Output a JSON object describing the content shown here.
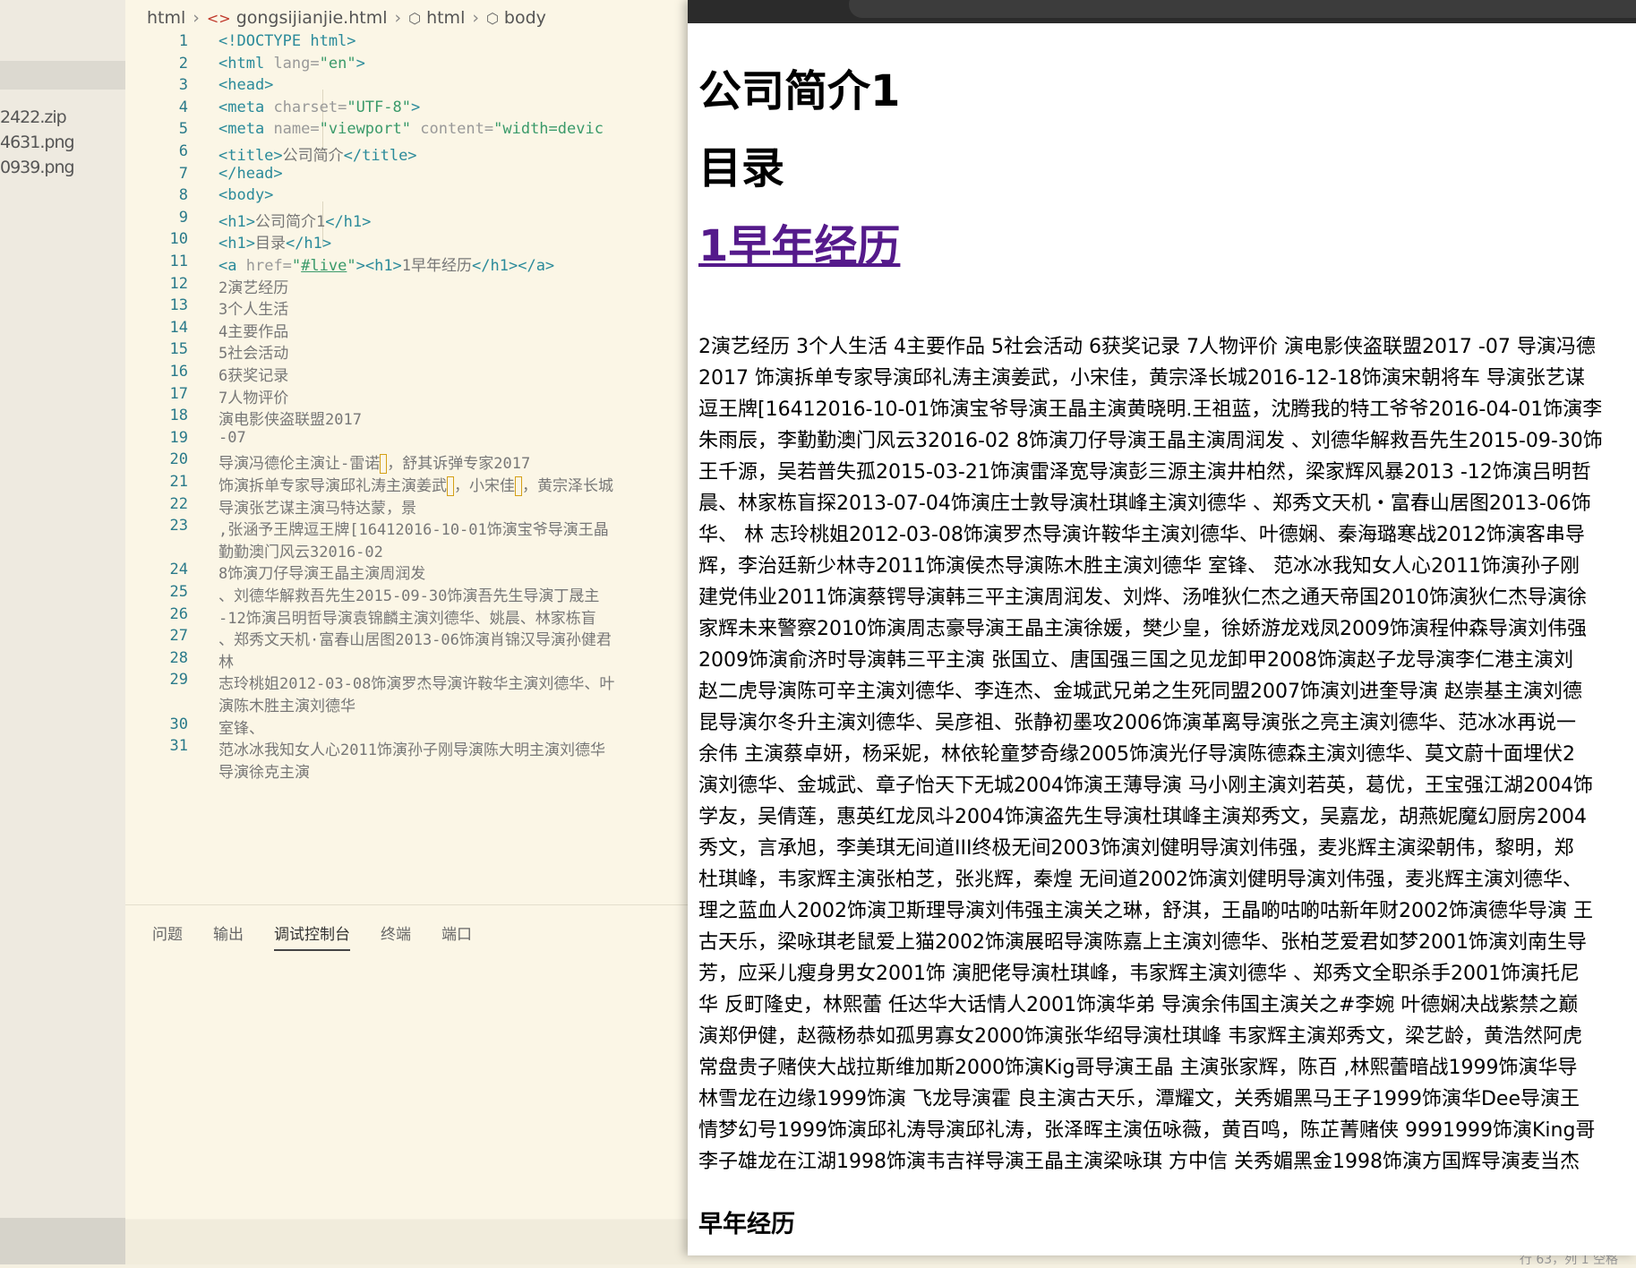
{
  "explorer": {
    "files": [
      "2422.zip",
      "4631.png",
      "0939.png"
    ]
  },
  "breadcrumb": [
    "html",
    "gongsijianjie.html",
    "html",
    "body"
  ],
  "code_lines": [
    {
      "n": "1",
      "html": "<span class='tag'>&lt;!DOCTYPE html&gt;</span>"
    },
    {
      "n": "2",
      "html": "<span class='tag'>&lt;html</span> <span class='attr'>lang=</span><span class='str'>\"en\"</span><span class='tag'>&gt;</span>"
    },
    {
      "n": "3",
      "html": "<span class='tag'>&lt;head&gt;</span>"
    },
    {
      "n": "4",
      "html": "    <span class='tag'>&lt;meta</span> <span class='attr'>charset=</span><span class='str'>\"UTF-8\"</span><span class='tag'>&gt;</span>"
    },
    {
      "n": "5",
      "html": "    <span class='tag'>&lt;meta</span> <span class='attr'>name=</span><span class='str'>\"viewport\"</span> <span class='attr'>content=</span><span class='str'>\"width=devic</span>"
    },
    {
      "n": "6",
      "html": "    <span class='tag'>&lt;title&gt;</span><span class='txt'>公司简介</span><span class='tag'>&lt;/title&gt;</span>"
    },
    {
      "n": "7",
      "html": "<span class='tag'>&lt;/head&gt;</span>"
    },
    {
      "n": "8",
      "html": "<span class='tag'>&lt;body&gt;</span>"
    },
    {
      "n": "9",
      "html": "   <span class='tag'>&lt;h1&gt;</span><span class='txt'>公司简介1</span><span class='tag'>&lt;/h1&gt;</span>"
    },
    {
      "n": "10",
      "html": "   <span class='tag'>&lt;h1&gt;</span><span class='txt'>目录</span><span class='tag'>&lt;/h1&gt;</span>"
    },
    {
      "n": "11",
      "html": "<span class='tag'>&lt;a</span> <span class='attr'>href=</span><span class='str'>\"<span class='link'>#live</span>\"</span><span class='tag'>&gt;&lt;h1&gt;</span><span class='txt'>1早年经历</span><span class='tag'>&lt;/h1&gt;&lt;/a&gt;</span>"
    },
    {
      "n": "12",
      "html": "<span class='txt'>2演艺经历</span>"
    },
    {
      "n": "13",
      "html": "<span class='txt'>3个人生活</span>"
    },
    {
      "n": "14",
      "html": "<span class='txt'>4主要作品</span>"
    },
    {
      "n": "15",
      "html": "<span class='txt'>5社会活动</span>"
    },
    {
      "n": "16",
      "html": "<span class='txt'>6获奖记录</span>"
    },
    {
      "n": "17",
      "html": "<span class='txt'>7人物评价</span>"
    },
    {
      "n": "18",
      "html": "<span class='txt'>演电影侠盗联盟2017</span>"
    },
    {
      "n": "19",
      "html": "<span class='txt'>-07</span>"
    },
    {
      "n": "20",
      "html": "<span class='txt'>导演冯德伦主演让-雷诺<span class='bx'></span>，舒其诉弹专家2017</span>"
    },
    {
      "n": "21",
      "html": "<span class='txt'>饰演拆单专家导演邱礼涛主演姜武<span class='bx'></span>，小宋佳<span class='bx'></span>，黄宗泽长城</span>"
    },
    {
      "n": "22",
      "html": "<span class='txt'>导演张艺谋主演马特达蒙，景</span>"
    },
    {
      "n": "23",
      "html": "<span class='txt'>,张涵予王牌逗王牌[16412016-10-01饰演宝爷导演王晶</span>"
    },
    {
      "n": "",
      "html": "<span class='txt'>勤勤澳门风云32016-02</span>"
    },
    {
      "n": "24",
      "html": "<span class='txt'>8饰演刀仔导演王晶主演周润发</span>"
    },
    {
      "n": "25",
      "html": "<span class='txt'>、刘德华解救吾先生2015-09-30饰演吾先生导演丁晟主</span>"
    },
    {
      "n": "26",
      "html": "<span class='txt'>-12饰演吕明哲导演袁锦麟主演刘德华、姚晨、林家栋盲</span>"
    },
    {
      "n": "27",
      "html": "<span class='txt'>、郑秀文天机·富春山居图2013-06饰演肖锦汉导演孙健君</span>"
    },
    {
      "n": "28",
      "html": "<span class='txt'>林</span>"
    },
    {
      "n": "29",
      "html": "<span class='txt'>志玲桃姐2012-03-08饰演罗杰导演许鞍华主演刘德华、叶</span>"
    },
    {
      "n": "",
      "html": "<span class='txt'>演陈木胜主演刘德华</span>"
    },
    {
      "n": "30",
      "html": "<span class='txt'>室锋、</span>"
    },
    {
      "n": "31",
      "html": "<span class='txt'>范冰冰我知女人心2011饰演孙子刚导演陈大明主演刘德华</span>"
    },
    {
      "n": "",
      "html": "<span class='txt'>导演徐克主演</span>"
    }
  ],
  "panel": {
    "tabs": [
      "问题",
      "输出",
      "调试控制台",
      "终端",
      "端口"
    ],
    "active_tab": "调试控制台",
    "prompt": ">"
  },
  "status": {
    "position": "行 63，列 1  空格"
  },
  "browser": {
    "h1_title": "公司简介1",
    "h1_toc": "目录",
    "h1_link": "1早年经历",
    "paragraph_lines": [
      "2演艺经历 3个人生活 4主要作品 5社会活动 6获奖记录 7人物评价 演电影侠盗联盟2017 -07 导演冯德",
      "2017 饰演拆单专家导演邱礼涛主演姜武，小宋佳，黄宗泽长城2016-12-18饰演宋朝将车 导演张艺谋",
      "逗王牌[16412016-10-01饰演宝爷导演王晶主演黄晓明.王祖蓝，沈腾我的特工爷爷2016-04-01饰演李",
      "朱雨辰，李勤勤澳门风云32016-02 8饰演刀仔导演王晶主演周润发 、刘德华解救吾先生2015-09-30饰",
      "王千源，吴若普失孤2015-03-21饰演雷泽宽导演彭三源主演井柏然，梁家辉风暴2013 -12饰演吕明哲",
      "晨、林家栋盲探2013-07-04饰演庄士敦导演杜琪峰主演刘德华 、郑秀文天机・富春山居图2013-06饰",
      "华、 林 志玲桃姐2012-03-08饰演罗杰导演许鞍华主演刘德华、叶德娴、秦海璐寒战2012饰演客串导",
      "辉，李治廷新少林寺2011饰演侯杰导演陈木胜主演刘德华 室锋、 范冰冰我知女人心2011饰演孙子刚",
      "建党伟业2011饰演蔡锷导演韩三平主演周润发、刘烨、汤唯狄仁杰之通天帝国2010饰演狄仁杰导演徐",
      "家辉未来警察2010饰演周志豪导演王晶主演徐媛，樊少皇，徐娇游龙戏凤2009饰演程仲森导演刘伟强",
      "2009饰演俞济时导演韩三平主演 张国立、唐国强三国之见龙卸甲2008饰演赵子龙导演李仁港主演刘",
      "赵二虎导演陈可辛主演刘德华、李连杰、金城武兄弟之生死同盟2007饰演刘进奎导演 赵崇基主演刘德",
      "昆导演尔冬升主演刘德华、吴彦祖、张静初墨攻2006饰演革离导演张之亮主演刘德华、范冰冰再说一",
      "余伟 主演蔡卓妍，杨采妮，林依轮童梦奇缘2005饰演光仔导演陈德森主演刘德华、莫文蔚十面埋伏2",
      "演刘德华、金城武、章子怡天下无城2004饰演王薄导演 马小刚主演刘若英，葛优，王宝强江湖2004饰",
      "学友，吴倩莲，惠英红龙凤斗2004饰演盗先生导演杜琪峰主演郑秀文，吴嘉龙，胡燕妮魔幻厨房2004",
      "秀文，言承旭，李美琪无间道III终极无间2003饰演刘健明导演刘伟强，麦兆辉主演梁朝伟，黎明，郑",
      "杜琪峰，韦家辉主演张柏芝，张兆辉，秦煌 无间道2002饰演刘健明导演刘伟强，麦兆辉主演刘德华、",
      "理之蓝血人2002饰演卫斯理导演刘伟强主演关之琳，舒淇，王晶啲咕啲咕新年财2002饰演德华导演 王",
      "古天乐，梁咏琪老鼠爱上猫2002饰演展昭导演陈嘉上主演刘德华、张柏芝爱君如梦2001饰演刘南生导",
      "芳，应采儿瘦身男女2001饰 演肥佬导演杜琪峰，韦家辉主演刘德华 、郑秀文全职杀手2001饰演托尼",
      "华 反町隆史，林熙蕾 任达华大话情人2001饰演华弟 导演余伟国主演关之#李婉 叶德娴决战紫禁之巅",
      "演郑伊健，赵薇杨恭如孤男寡女2000饰演张华绍导演杜琪峰 韦家辉主演郑秀文，梁艺龄，黄浩然阿虎",
      "常盘贵子赌侠大战拉斯维加斯2000饰演Kig哥导演王晶 主演张家辉，陈百 ,林熙蕾暗战1999饰演华导",
      "林雪龙在边缘1999饰演 飞龙导演霍 良主演古天乐，潭耀文，关秀媚黑马王子1999饰演华Dee导演王",
      "情梦幻号1999饰演邱礼涛导演邱礼涛，张泽晖主演伍咏薇，黄百鸣，陈芷菁赌侠 9991999饰演King哥",
      "李子雄龙在江湖1998饰演韦吉祥导演王晶主演梁咏琪 方中信 关秀媚黑金1998饰演方国辉导演麦当杰"
    ],
    "h2_bottom": "早年经历"
  }
}
